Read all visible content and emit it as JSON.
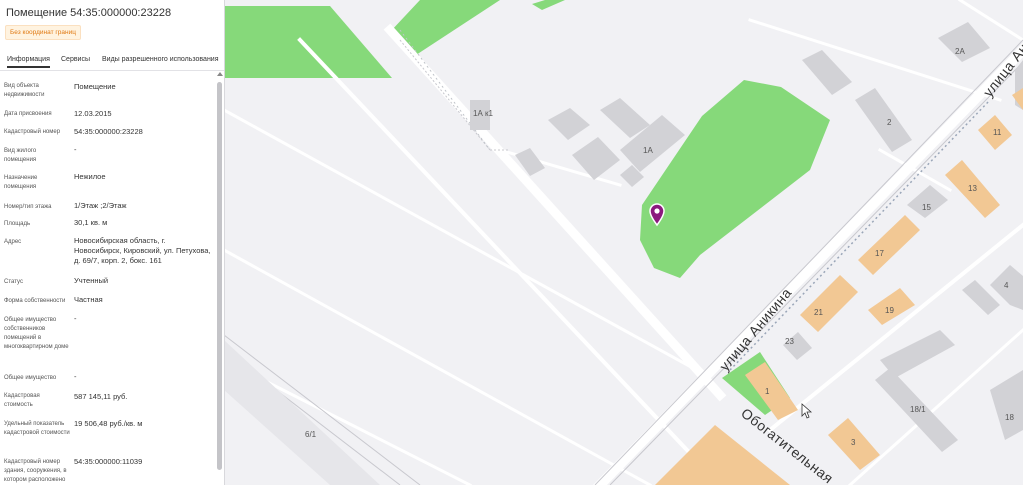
{
  "panel": {
    "title": "Помещение 54:35:000000:23228",
    "badge": "Без координат границ",
    "tabs": [
      {
        "label": "Информация"
      },
      {
        "label": "Сервисы"
      },
      {
        "label": "Виды разрешенного использования"
      }
    ],
    "properties": [
      {
        "label": "Вид объекта недвижимости",
        "value": "Помещение"
      },
      {
        "label": "Дата присвоения",
        "value": "12.03.2015"
      },
      {
        "label": "Кадастровый номер",
        "value": "54:35:000000:23228"
      },
      {
        "label": "Вид жилого помещения",
        "value": "-"
      },
      {
        "label": "Назначение помещения",
        "value": "Нежилое"
      },
      {
        "label": "Номер/тип этажа",
        "value": "1/Этаж ;2/Этаж"
      },
      {
        "label": "Площадь",
        "value": "30,1 кв. м"
      },
      {
        "label": "Адрес",
        "value": "Новосибирская область, г. Новосибирск, Кировский, ул. Петухова, д. 69/7, корп. 2, бокс. 161"
      },
      {
        "label": "Статус",
        "value": "Учтенный"
      },
      {
        "label": "Форма собственности",
        "value": "Частная"
      },
      {
        "label": "Общее имущество собственников помещений в многоквартирном доме",
        "value": "-"
      },
      {
        "label": "Общее имущество",
        "value": "-"
      },
      {
        "label": "Кадастровая стоимость",
        "value": "587 145,11 руб."
      },
      {
        "label": "Удельный показатель кадастровой стоимости",
        "value": "19 506,48 руб./кв. м"
      },
      {
        "label": "Кадастровый номер здания, сооружения, в котором расположено",
        "value": "54:35:000000:11039"
      }
    ]
  },
  "map": {
    "streets": [
      "улица Аникина",
      "Обогатительная"
    ],
    "labels": {
      "b2a": "2А",
      "b1ak1": "1А к1",
      "b1a": "1А",
      "b2": "2",
      "b11": "11",
      "b13": "13",
      "b15": "15",
      "b17": "17",
      "b21": "21",
      "b19": "19",
      "b4": "4",
      "b23": "23",
      "b1": "1",
      "b3": "3",
      "b18_1": "18/1",
      "b18": "18",
      "b6_1": "6/1"
    },
    "colors": {
      "park": "#86d97a",
      "building": "#d2d2d6",
      "house": "#f2c894",
      "pin": "#8b1a7e",
      "road": "#ffffff"
    }
  }
}
